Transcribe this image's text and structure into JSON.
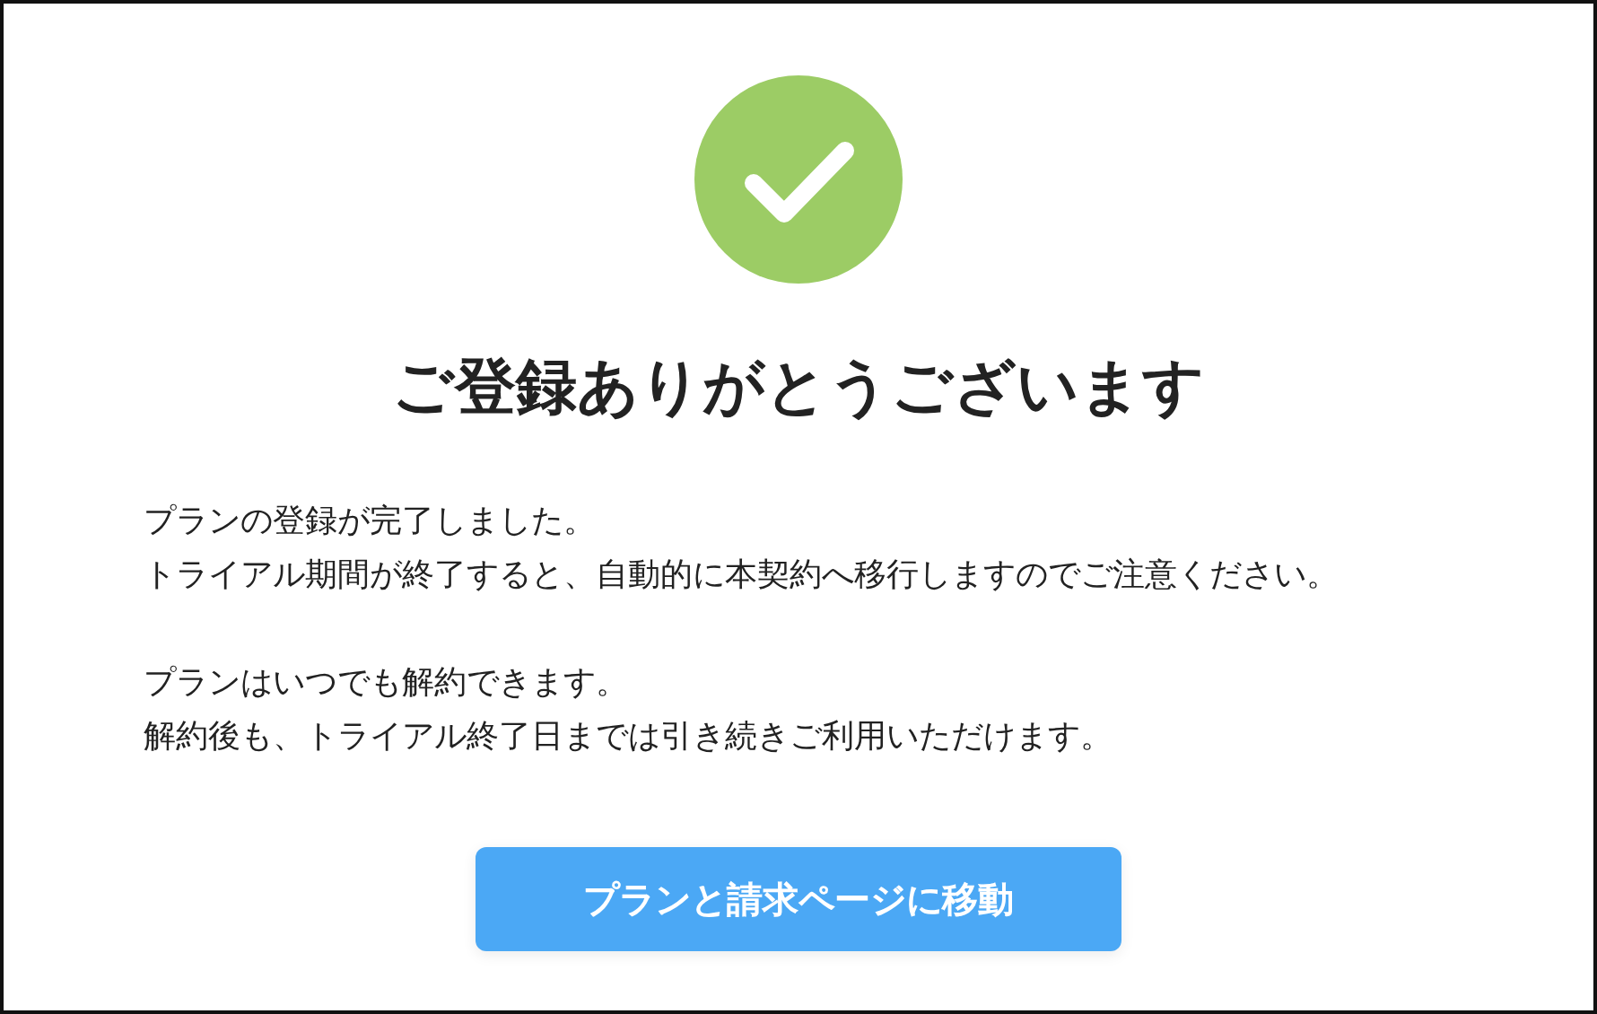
{
  "title": "ご登録ありがとうございます",
  "paragraphs": [
    {
      "lines": [
        "プランの登録が完了しました。",
        "トライアル期間が終了すると、自動的に本契約へ移行しますのでご注意ください。"
      ]
    },
    {
      "lines": [
        "プランはいつでも解約できます。",
        "解約後も、トライアル終了日までは引き続きご利用いただけます。"
      ]
    }
  ],
  "button": {
    "label": "プランと請求ページに移動"
  }
}
